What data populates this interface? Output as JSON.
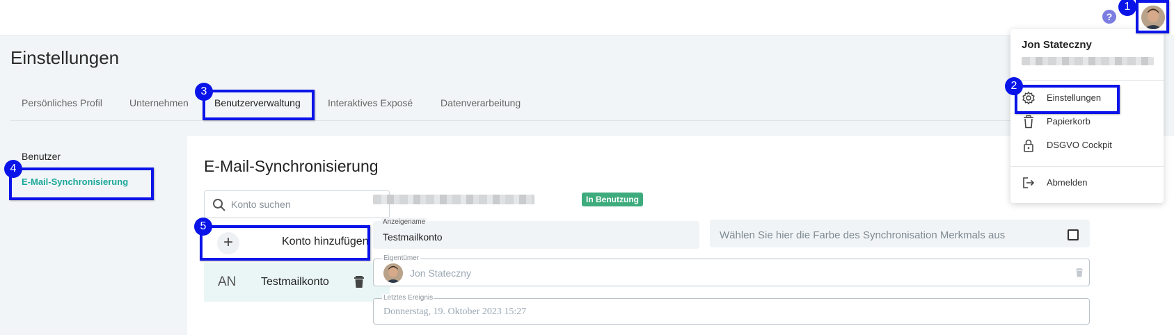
{
  "header": {
    "help_icon": "help-circle-icon",
    "avatar_icon": "user-avatar"
  },
  "page": {
    "title": "Einstellungen"
  },
  "tabs": [
    {
      "label": "Persönliches Profil"
    },
    {
      "label": "Unternehmen"
    },
    {
      "label": "Benutzerverwaltung"
    },
    {
      "label": "Interaktives Exposé"
    },
    {
      "label": "Datenverarbeitung"
    }
  ],
  "sidenav": {
    "items": [
      {
        "label": "Benutzer"
      },
      {
        "label": "E-Mail-Synchronisierung"
      }
    ]
  },
  "main": {
    "title": "E-Mail-Synchronisierung",
    "search": {
      "placeholder": "Konto suchen",
      "value": ""
    },
    "add_account_label": "Konto hinzufügen",
    "accounts": [
      {
        "abbr": "AN",
        "name": "Testmailkonto"
      }
    ],
    "status_badge": "In Benutzung",
    "display_name": {
      "label": "Anzeigename",
      "value": "Testmailkonto"
    },
    "color_picker": {
      "label": "Wählen Sie hier die Farbe des Synchronisation Merkmals aus"
    },
    "owner": {
      "label": "Eigentümer",
      "value": "Jon Stateczny"
    },
    "last_event": {
      "label": "Letztes Ereignis",
      "value": "Donnerstag, 19. Oktober 2023 15:27"
    }
  },
  "user_menu": {
    "name": "Jon Stateczny",
    "items": [
      {
        "label": "Einstellungen",
        "icon": "gear-icon"
      },
      {
        "label": "Papierkorb",
        "icon": "trash-icon"
      },
      {
        "label": "DSGVO Cockpit",
        "icon": "lock-icon"
      },
      {
        "label": "Abmelden",
        "icon": "logout-icon"
      }
    ]
  },
  "annotations": [
    "1",
    "2",
    "3",
    "4",
    "5"
  ],
  "colors": {
    "accent": "#1aa89a",
    "badge": "#3eab7d",
    "highlight": "#0a14e8",
    "help": "#7b7de0"
  }
}
